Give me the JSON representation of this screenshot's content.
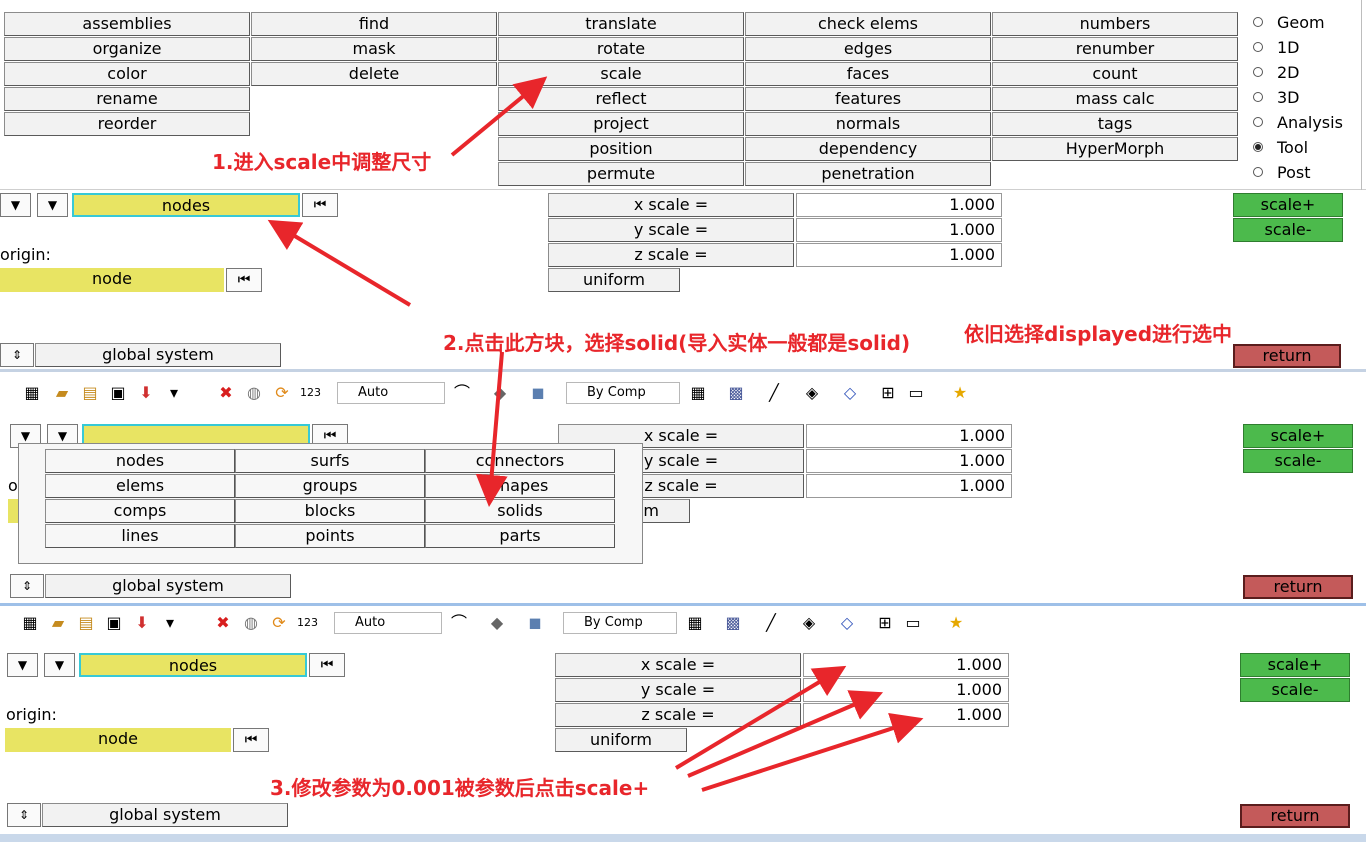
{
  "menu": {
    "col1": [
      "assemblies",
      "organize",
      "color",
      "rename",
      "reorder"
    ],
    "col2": [
      "find",
      "mask",
      "delete"
    ],
    "col3": [
      "translate",
      "rotate",
      "scale",
      "reflect",
      "project",
      "position",
      "permute"
    ],
    "col4": [
      "check elems",
      "edges",
      "faces",
      "features",
      "normals",
      "dependency",
      "penetration"
    ],
    "col5": [
      "numbers",
      "renumber",
      "count",
      "mass calc",
      "tags",
      "HyperMorph"
    ],
    "radios": [
      "Geom",
      "1D",
      "2D",
      "3D",
      "Analysis",
      "Tool",
      "Post"
    ],
    "radio_selected": "Tool"
  },
  "scale_panel": {
    "entity": "nodes",
    "origin_label": "origin:",
    "origin_entity": "node",
    "x_label": "x scale =",
    "y_label": "y scale =",
    "z_label": "z scale =",
    "x_value": "1.000",
    "y_value": "1.000",
    "z_value": "1.000",
    "uniform": "uniform",
    "system": "global system",
    "scale_plus": "scale+",
    "scale_minus": "scale-",
    "return": "return"
  },
  "toolbar": {
    "auto_label": "Auto",
    "bycomp_label": "By Comp"
  },
  "popup": {
    "items": [
      "nodes",
      "surfs",
      "connectors",
      "elems",
      "groups",
      "shapes",
      "comps",
      "blocks",
      "solids",
      "lines",
      "points",
      "parts"
    ]
  },
  "panel2_values": {
    "x": "1.000",
    "y": "1.000",
    "z": "1.000"
  },
  "panel2_partial": {
    "x": "x scale =",
    "y": "y scale =",
    "z": "z scale =",
    "uniform": "m",
    "origin": "o"
  },
  "annotations": {
    "step1": "1.进入scale中调整尺寸",
    "step2": "2.点击此方块，选择solid(导入实体一般都是solid)",
    "step2b": "依旧选择displayed进行选中",
    "step3": "3.修改参数为0.001被参数后点击scale+"
  },
  "colors": {
    "annotation": "#e8262b",
    "green_button": "#4cba4c",
    "return_button": "#c45a5a",
    "selector_yellow": "#e8e463",
    "selector_border": "#37c9d6"
  }
}
